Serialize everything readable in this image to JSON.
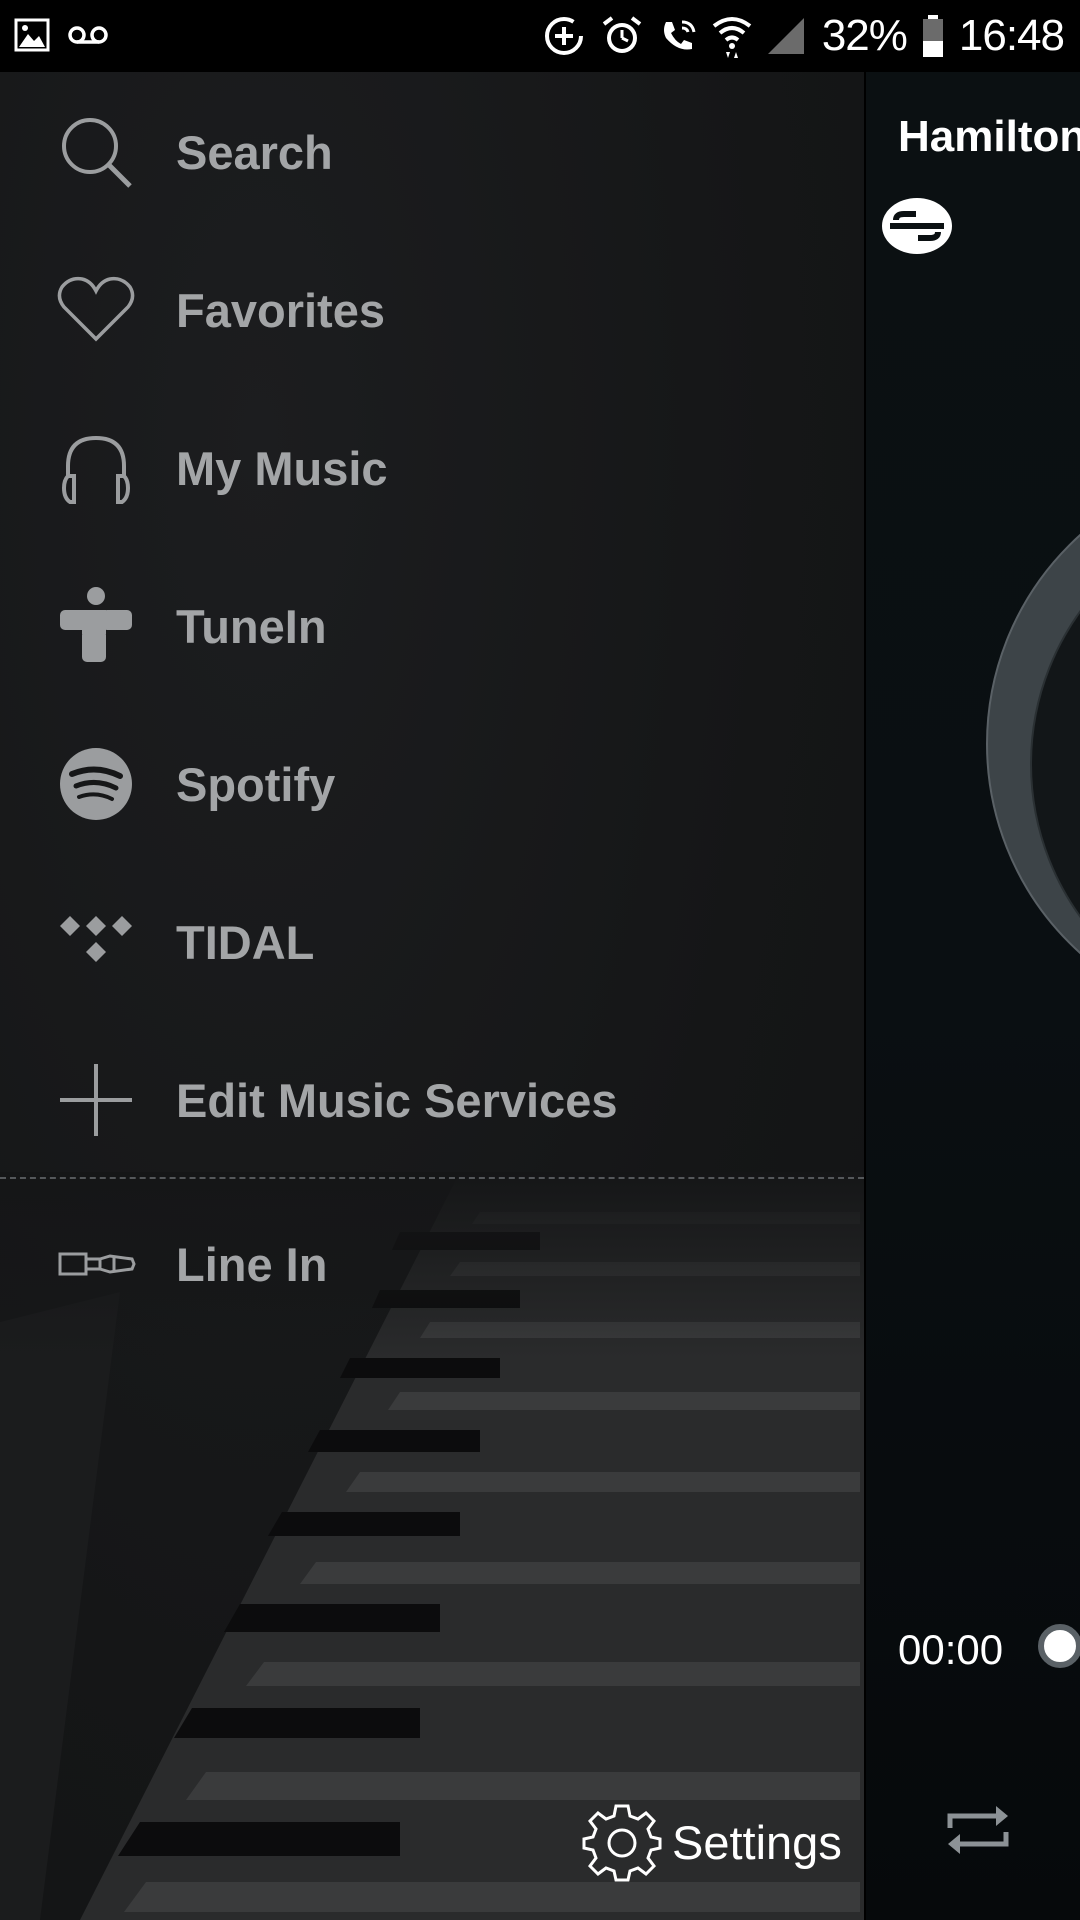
{
  "status_bar": {
    "battery_percent": "32%",
    "time": "16:48"
  },
  "drawer": {
    "items": [
      {
        "label": "Search"
      },
      {
        "label": "Favorites"
      },
      {
        "label": "My Music"
      },
      {
        "label": "TuneIn"
      },
      {
        "label": "Spotify"
      },
      {
        "label": "TIDAL"
      },
      {
        "label": "Edit Music Services"
      },
      {
        "label": "Line In"
      }
    ],
    "settings_label": "Settings"
  },
  "now_playing": {
    "title": "Hamilton",
    "elapsed_time": "00:00"
  }
}
